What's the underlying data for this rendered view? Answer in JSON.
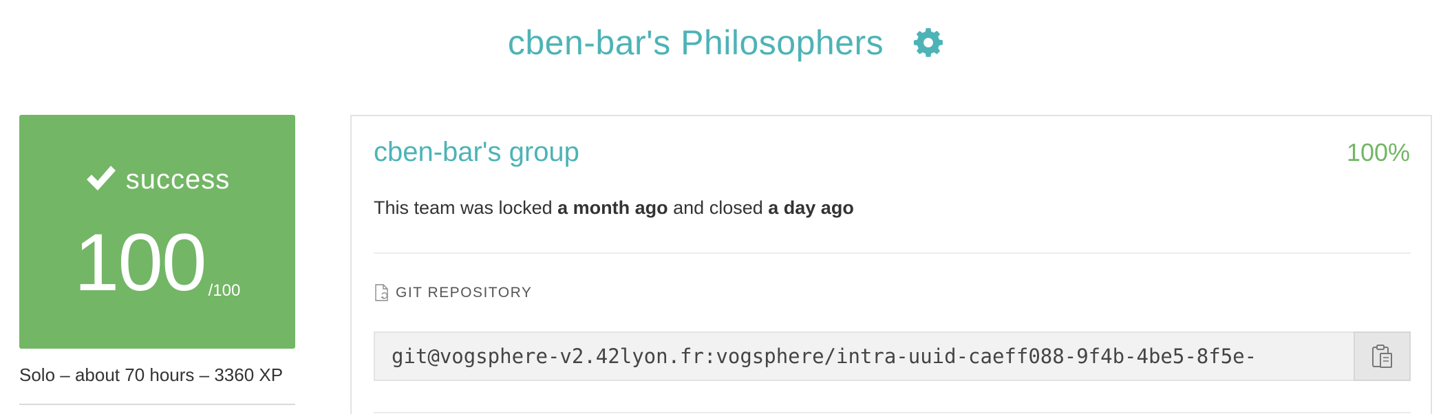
{
  "header": {
    "title": "cben-bar's Philosophers",
    "settings_icon": "gear-icon"
  },
  "score_card": {
    "status_icon": "check-icon",
    "status": "success",
    "score": "100",
    "max_score": "/100",
    "background_color": "#73b666"
  },
  "project_meta": "Solo – about 70 hours – 3360 XP",
  "team": {
    "name": "cben-bar's group",
    "percent": "100%",
    "status_prefix": "This team was locked",
    "locked_when": "a month ago",
    "status_middle": "and closed",
    "closed_when": "a day ago"
  },
  "repository": {
    "icon": "repo-icon",
    "label": "GIT REPOSITORY",
    "url": "git@vogsphere-v2.42lyon.fr:vogsphere/intra-uuid-caeff088-9f4b-4be5-8f5e-",
    "copy_icon": "clipboard-icon"
  },
  "colors": {
    "accent_teal": "#4db3b6",
    "success_green": "#73b666"
  }
}
